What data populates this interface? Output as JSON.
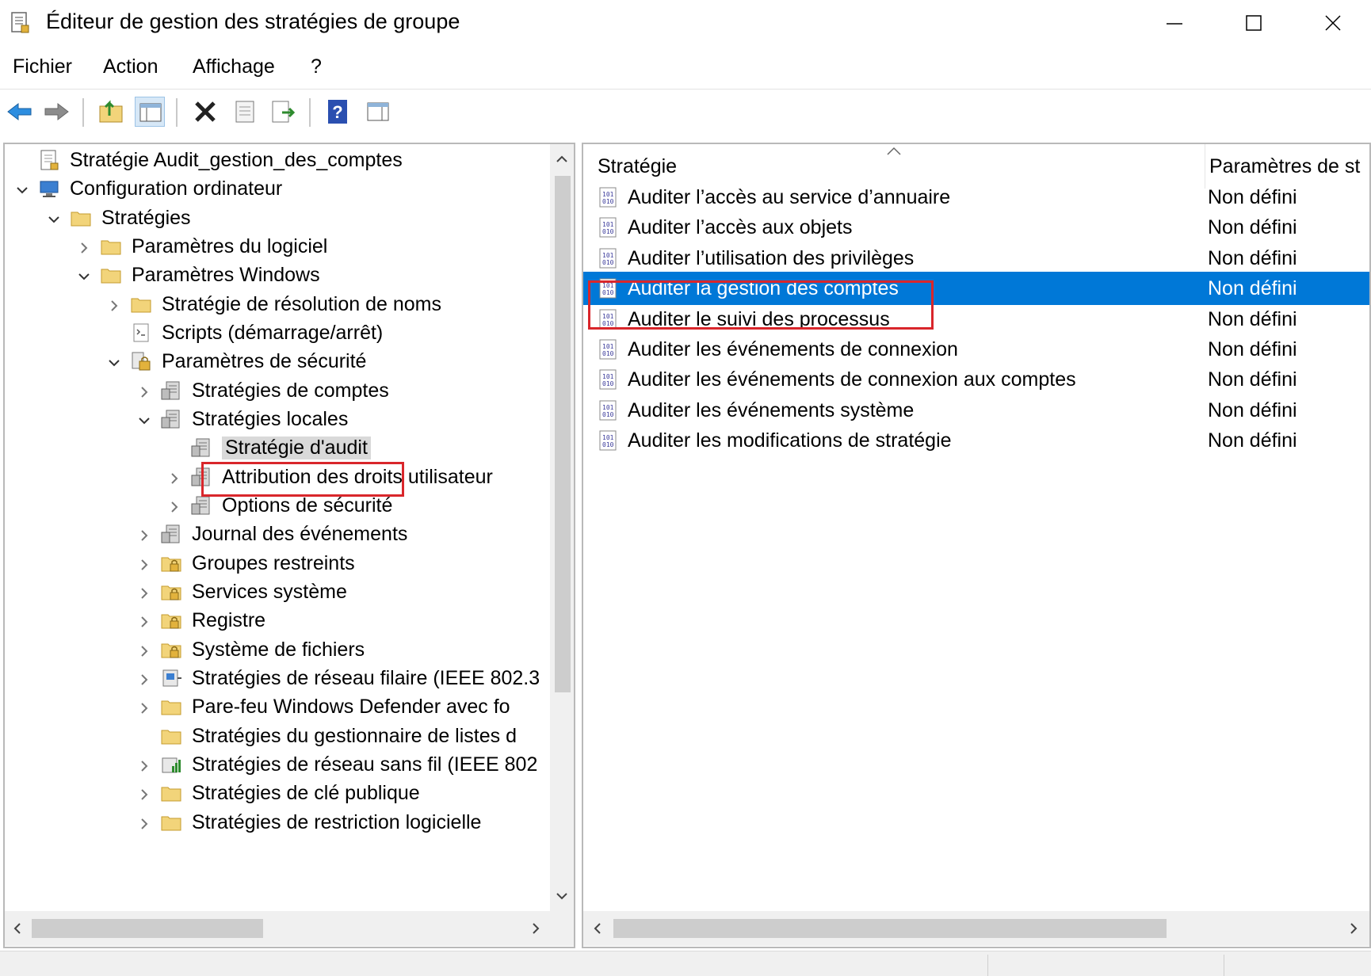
{
  "window": {
    "title": "Éditeur de gestion des stratégies de groupe",
    "controls": {
      "minimize_icon": "minimize-icon",
      "maximize_icon": "maximize-icon",
      "close_icon": "close-icon"
    }
  },
  "menu": [
    "Fichier",
    "Action",
    "Affichage",
    "?"
  ],
  "toolbar": {
    "buttons": [
      "back-icon",
      "forward-icon",
      "up-folder-icon",
      "show-hide-tree-icon",
      "delete-icon",
      "properties-icon",
      "export-list-icon",
      "help-icon",
      "show-hide-action-pane-icon"
    ]
  },
  "tree": [
    {
      "label": "Stratégie Audit_gestion_des_comptes",
      "icon": "policy-document-icon",
      "expander": "none"
    },
    {
      "label": "Configuration ordinateur",
      "icon": "computer-icon",
      "expander": "expanded"
    },
    {
      "label": "Stratégies",
      "icon": "folder-icon",
      "expander": "expanded"
    },
    {
      "label": "Paramètres du logiciel",
      "icon": "folder-icon",
      "expander": "collapsed"
    },
    {
      "label": "Paramètres Windows",
      "icon": "folder-icon",
      "expander": "expanded"
    },
    {
      "label": "Stratégie de résolution de noms",
      "icon": "folder-icon",
      "expander": "collapsed"
    },
    {
      "label": "Scripts (démarrage/arrêt)",
      "icon": "script-icon",
      "expander": "none"
    },
    {
      "label": "Paramètres de sécurité",
      "icon": "security-settings-icon",
      "expander": "expanded"
    },
    {
      "label": "Stratégies de comptes",
      "icon": "policy-folder-icon",
      "expander": "collapsed"
    },
    {
      "label": "Stratégies locales",
      "icon": "policy-folder-icon",
      "expander": "expanded"
    },
    {
      "label": "Stratégie d'audit",
      "icon": "policy-folder-icon",
      "expander": "none",
      "selected": true
    },
    {
      "label": "Attribution des droits utilisateur",
      "icon": "policy-folder-icon",
      "expander": "collapsed"
    },
    {
      "label": "Options de sécurité",
      "icon": "policy-folder-icon",
      "expander": "collapsed"
    },
    {
      "label": "Journal des événements",
      "icon": "policy-folder-icon",
      "expander": "collapsed"
    },
    {
      "label": "Groupes restreints",
      "icon": "locked-folder-icon",
      "expander": "collapsed"
    },
    {
      "label": "Services système",
      "icon": "locked-folder-icon",
      "expander": "collapsed"
    },
    {
      "label": "Registre",
      "icon": "locked-folder-icon",
      "expander": "collapsed"
    },
    {
      "label": "Système de fichiers",
      "icon": "locked-folder-icon",
      "expander": "collapsed"
    },
    {
      "label": "Stratégies de réseau filaire (IEEE 802.3",
      "icon": "wired-network-icon",
      "expander": "collapsed"
    },
    {
      "label": "Pare-feu Windows Defender avec fo",
      "icon": "folder-icon",
      "expander": "collapsed"
    },
    {
      "label": "Stratégies du gestionnaire de listes d",
      "icon": "folder-icon",
      "expander": "none"
    },
    {
      "label": "Stratégies de réseau sans fil (IEEE 802",
      "icon": "wireless-network-icon",
      "expander": "collapsed"
    },
    {
      "label": "Stratégies de clé publique",
      "icon": "folder-icon",
      "expander": "collapsed"
    },
    {
      "label": "Stratégies de restriction logicielle",
      "icon": "folder-icon",
      "expander": "collapsed"
    }
  ],
  "list": {
    "headers": [
      "Stratégie",
      "Paramètres de st"
    ],
    "rows": [
      {
        "name": "Auditer l’accès au service d’annuaire",
        "value": "Non défini"
      },
      {
        "name": "Auditer l’accès aux objets",
        "value": "Non défini"
      },
      {
        "name": "Auditer l’utilisation des privilèges",
        "value": "Non défini"
      },
      {
        "name": "Auditer la gestion des comptes",
        "value": "Non défini",
        "selected": true
      },
      {
        "name": "Auditer le suivi des processus",
        "value": "Non défini"
      },
      {
        "name": "Auditer les événements de connexion",
        "value": "Non défini"
      },
      {
        "name": "Auditer les événements de connexion aux comptes",
        "value": "Non défini"
      },
      {
        "name": "Auditer les événements système",
        "value": "Non défini"
      },
      {
        "name": "Auditer les modifications de stratégie",
        "value": "Non défini"
      }
    ]
  },
  "colors": {
    "selection": "#0078d7",
    "annotation": "#d9262b",
    "folder": "#f2d47a"
  }
}
